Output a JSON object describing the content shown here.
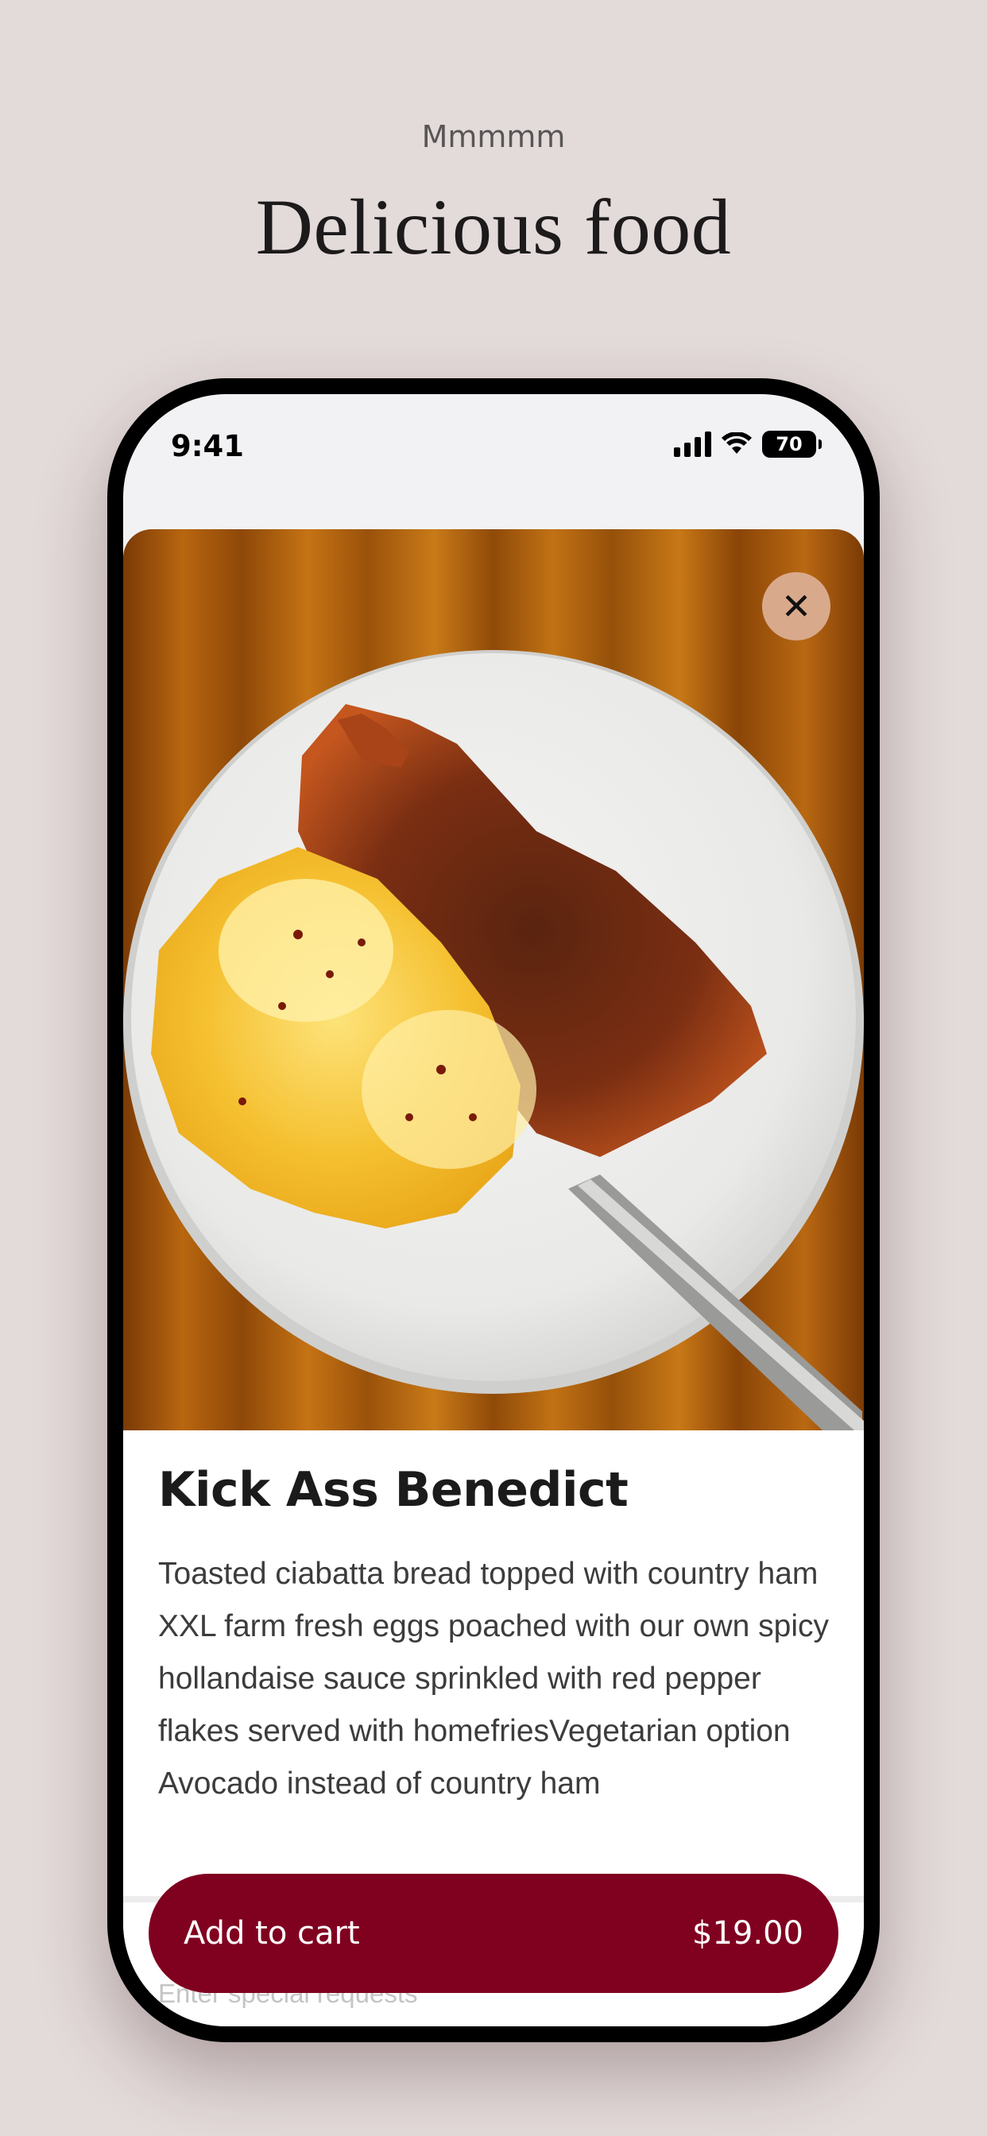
{
  "page": {
    "eyebrow": "Mmmmm",
    "headline": "Delicious food"
  },
  "status_bar": {
    "time": "9:41",
    "battery": "70",
    "icons": [
      "cellular-signal-icon",
      "wifi-icon",
      "battery-icon"
    ]
  },
  "product": {
    "image_subject": "eggs benedict with hash brown on a white plate",
    "name": "Kick Ass Benedict",
    "description": "Toasted ciabatta bread topped with country ham XXL farm fresh eggs poached with our own spicy hollandaise sauce sprinkled with red pepper flakes served with homefriesVegetarian option Avocado instead of country ham",
    "special_requests_placeholder": "Enter special requests"
  },
  "cart": {
    "label": "Add to cart",
    "price": "$19.00"
  },
  "colors": {
    "background": "#e3dada",
    "accent": "#800020",
    "close_button": "#d9a98c"
  }
}
